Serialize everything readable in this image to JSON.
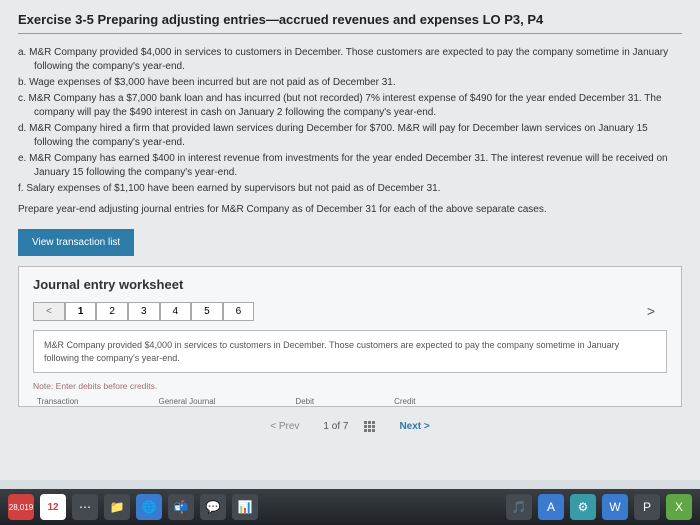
{
  "title": "Exercise 3-5 Preparing adjusting entries—accrued revenues and expenses LO P3, P4",
  "items": {
    "a": "a. M&R Company provided $4,000 in services to customers in December. Those customers are expected to pay the company sometime in January following the company's year-end.",
    "b": "b. Wage expenses of $3,000 have been incurred but are not paid as of December 31.",
    "c": "c. M&R Company has a $7,000 bank loan and has incurred (but not recorded) 7% interest expense of $490 for the year ended December 31. The company will pay the $490 interest in cash on January 2 following the company's year-end.",
    "d": "d. M&R Company hired a firm that provided lawn services during December for $700. M&R will pay for December lawn services on January 15 following the company's year-end.",
    "e": "e. M&R Company has earned $400 in interest revenue from investments for the year ended December 31. The interest revenue will be received on January 15 following the company's year-end.",
    "f": "f. Salary expenses of $1,100 have been earned by supervisors but not paid as of December 31."
  },
  "instruction": "Prepare year-end adjusting journal entries for M&R Company as of December 31 for each of the above separate cases.",
  "viewBtn": "View transaction list",
  "worksheet": {
    "title": "Journal entry worksheet",
    "tabs": {
      "left": "<",
      "t1": "1",
      "t2": "2",
      "t3": "3",
      "t4": "4",
      "t5": "5",
      "t6": "6",
      "right": ">"
    },
    "desc": "M&R Company provided $4,000 in services to customers in December. Those customers are expected to pay the company sometime in January following the company's year-end.",
    "note": "Note: Enter debits before credits.",
    "headers": {
      "a": "Transaction",
      "b": "General Journal",
      "c": "Debit",
      "d": "Credit"
    }
  },
  "nav": {
    "prev": "< Prev",
    "count": "1 of 7",
    "next": "Next >"
  },
  "taskbar": {
    "badge": "28,019",
    "date": "12"
  }
}
